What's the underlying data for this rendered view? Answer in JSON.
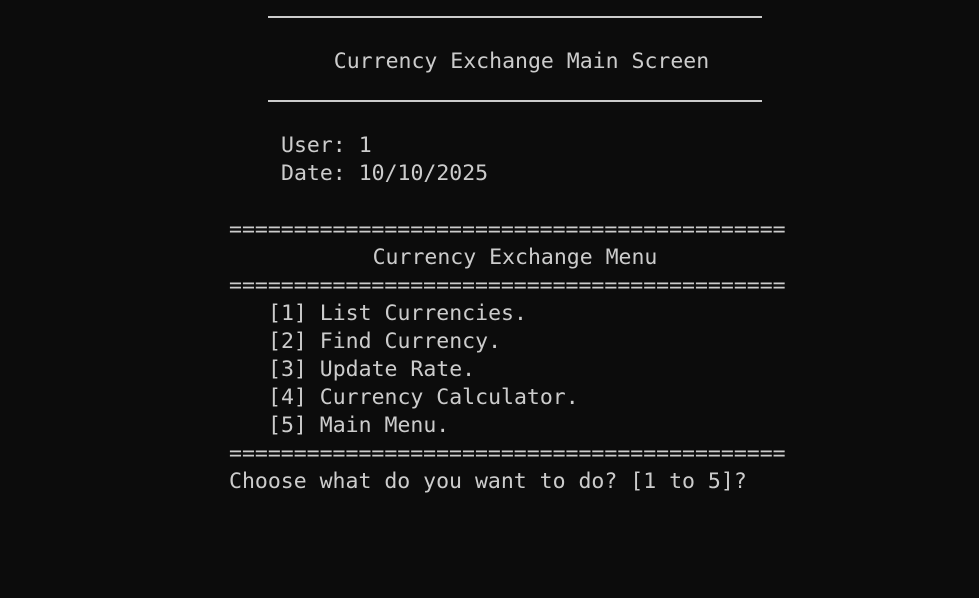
{
  "header": {
    "title": "Currency Exchange Main Screen"
  },
  "info": {
    "user_label": "User:",
    "user_value": "1",
    "date_label": "Date:",
    "date_value": "10/10/2025"
  },
  "menu": {
    "separator": "===========================================",
    "title": "Currency Exchange Menu",
    "items": [
      {
        "key": "[1]",
        "label": "List Currencies."
      },
      {
        "key": "[2]",
        "label": "Find Currency."
      },
      {
        "key": "[3]",
        "label": "Update Rate."
      },
      {
        "key": "[4]",
        "label": "Currency Calculator."
      },
      {
        "key": "[5]",
        "label": "Main Menu."
      }
    ],
    "prompt": "Choose what do you want to do? [1 to 5]?"
  }
}
